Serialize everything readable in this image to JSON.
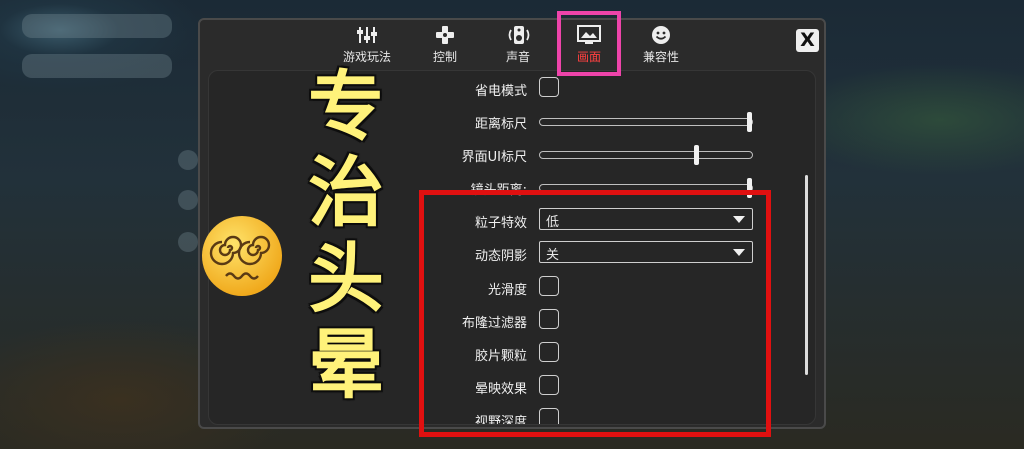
{
  "tabs": [
    {
      "label": "游戏玩法",
      "icon": "sliders-icon"
    },
    {
      "label": "控制",
      "icon": "gamepad-icon"
    },
    {
      "label": "声音",
      "icon": "speaker-icon"
    },
    {
      "label": "画面",
      "icon": "display-icon",
      "active": true
    },
    {
      "label": "兼容性",
      "icon": "smiley-icon"
    }
  ],
  "close_label": "X",
  "settings": {
    "power_saving": {
      "label": "省电模式",
      "checked": false
    },
    "distance_scale": {
      "label": "距离标尺",
      "level": 1.0
    },
    "ui_scale": {
      "label": "界面UI标尺",
      "level": 0.73
    },
    "camera_distance": {
      "label": "镜头距离:",
      "level": 1.0
    },
    "particle_effects": {
      "label": "粒子特效",
      "value": "低"
    },
    "dynamic_shadows": {
      "label": "动态阴影",
      "value": "关"
    },
    "smoothness": {
      "label": "光滑度",
      "checked": false
    },
    "bloom_filter": {
      "label": "布隆过滤器",
      "checked": false
    },
    "film_grain": {
      "label": "胶片颗粒",
      "checked": false
    },
    "vignette": {
      "label": "晕映效果",
      "checked": false
    },
    "depth_of_field": {
      "label": "视野深度",
      "checked": false
    }
  },
  "overlay": {
    "caption": [
      "专",
      "治",
      "头",
      "晕"
    ],
    "emoji": "dizzy-face-emoji",
    "highlight_colors": {
      "tab": "#ee44aa",
      "box": "#e01010"
    },
    "caption_color": "#fff27a"
  }
}
